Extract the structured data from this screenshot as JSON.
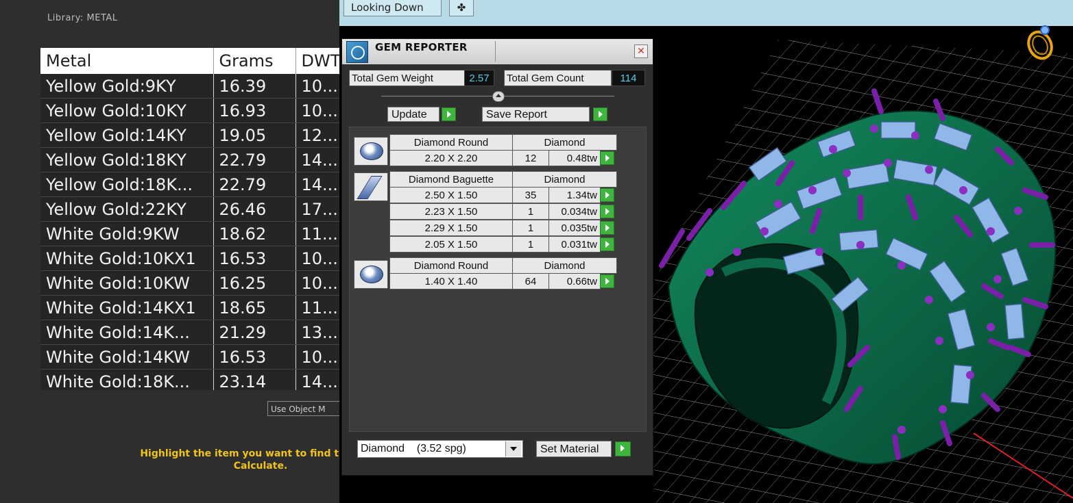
{
  "library": {
    "label": "Library: METAL"
  },
  "metal_table": {
    "headers": [
      "Metal",
      "Grams",
      "DWT"
    ],
    "rows": [
      [
        "Yellow Gold:9KY",
        "16.39",
        "10..."
      ],
      [
        "Yellow Gold:10KY",
        "16.93",
        "10..."
      ],
      [
        "Yellow Gold:14KY",
        "19.05",
        "12..."
      ],
      [
        "Yellow Gold:18KY",
        "22.79",
        "14..."
      ],
      [
        "Yellow Gold:18K...",
        "22.79",
        "14..."
      ],
      [
        "Yellow Gold:22KY",
        "26.46",
        "17..."
      ],
      [
        "White Gold:9KW",
        "18.62",
        "11..."
      ],
      [
        "White Gold:10KX1",
        "16.53",
        "10..."
      ],
      [
        "White Gold:10KW",
        "16.25",
        "10..."
      ],
      [
        "White Gold:14KX1",
        "18.65",
        "11..."
      ],
      [
        "White Gold:14K...",
        "21.29",
        "13..."
      ],
      [
        "White Gold:14KW",
        "16.53",
        "10..."
      ],
      [
        "White Gold:18K...",
        "23.14",
        "14..."
      ]
    ]
  },
  "use_object_button": "Use Object M",
  "highlight_message": {
    "line1": "Highlight the item you want to find the weig",
    "line2": "Calculate."
  },
  "tabs": {
    "looking_down": "Looking Down",
    "add_glyph": "✤"
  },
  "gem_reporter": {
    "title": "GEM REPORTER",
    "close_glyph": "✕",
    "total_gem_weight_label": "Total Gem Weight",
    "total_gem_weight_value": "2.57",
    "total_gem_count_label": "Total Gem Count",
    "total_gem_count_value": "114",
    "update_label": "Update",
    "save_report_label": "Save Report",
    "groups": [
      {
        "shape": "Diamond Round",
        "material": "Diamond",
        "icon": "round-gem-icon",
        "rows": [
          {
            "size": "2.20 X 2.20",
            "count": "12",
            "weight": "0.48tw"
          }
        ]
      },
      {
        "shape": "Diamond Baguette",
        "material": "Diamond",
        "icon": "baguette-gem-icon",
        "rows": [
          {
            "size": "2.50 X 1.50",
            "count": "35",
            "weight": "1.34tw"
          },
          {
            "size": "2.23 X 1.50",
            "count": "1",
            "weight": "0.034tw"
          },
          {
            "size": "2.29 X 1.50",
            "count": "1",
            "weight": "0.035tw"
          },
          {
            "size": "2.05 X 1.50",
            "count": "1",
            "weight": "0.031tw"
          }
        ]
      },
      {
        "shape": "Diamond Round",
        "material": "Diamond",
        "icon": "round-gem-icon",
        "rows": [
          {
            "size": "1.40 X 1.40",
            "count": "64",
            "weight": "0.66tw"
          }
        ]
      }
    ],
    "material_select": "Diamond    (3.52 spg)",
    "set_material_label": "Set Material"
  },
  "colors": {
    "accent_value": "#4fd0f2",
    "go_button": "#3fb53f",
    "message": "#f0c419",
    "tab_bar": "#b7dbe6",
    "ring_metal": "#0f6b4a",
    "prongs": "#7a1fa8",
    "stones": "#8fb8e8"
  }
}
